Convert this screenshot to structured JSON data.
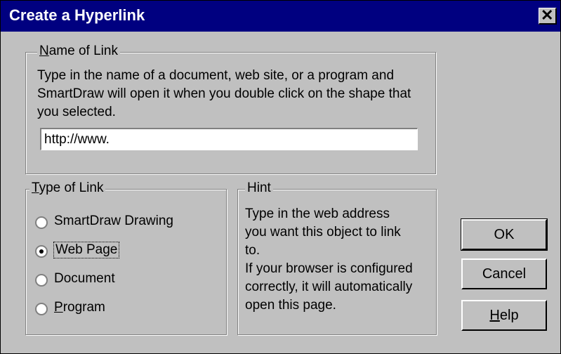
{
  "window": {
    "title": "Create a Hyperlink",
    "close_glyph": "✕"
  },
  "name_group": {
    "legend_mnemonic": "N",
    "legend_rest": "ame of Link",
    "description": "Type in the name of a document, web site, or a program and SmartDraw will open it when you double click on the shape that you selected.",
    "input_value": "http://www."
  },
  "type_group": {
    "legend_mnemonic": "T",
    "legend_rest": "ype of Link",
    "options": [
      {
        "label": "SmartDraw Drawing",
        "checked": false
      },
      {
        "label": "Web Page",
        "checked": true
      },
      {
        "label": "Document",
        "checked": false
      },
      {
        "label_mnemonic": "P",
        "label_rest": "rogram",
        "checked": false
      }
    ]
  },
  "hint_group": {
    "legend": "Hint",
    "text_lines": [
      "Type in the web address",
      "you want this object to link",
      "to.",
      "If your browser is configured",
      "correctly, it will automatically",
      "open this page."
    ]
  },
  "buttons": {
    "ok": "OK",
    "cancel": "Cancel",
    "help_mnemonic": "H",
    "help_rest": "elp"
  },
  "colors": {
    "titlebar": "#000080",
    "face": "#c0c0c0",
    "shadow": "#808080"
  },
  "icons": {
    "close": "close-icon",
    "radio": "radio-icon"
  }
}
